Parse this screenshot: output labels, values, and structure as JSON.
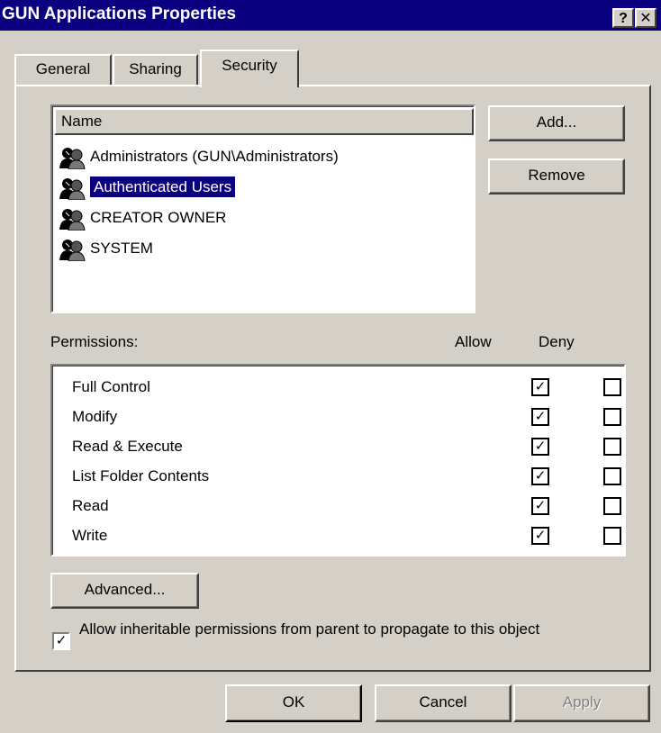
{
  "window": {
    "title": "GUN Applications Properties",
    "help_glyph": "?",
    "close_glyph": "✕"
  },
  "tabs": [
    {
      "label": "General"
    },
    {
      "label": "Sharing"
    },
    {
      "label": "Security",
      "active": true
    }
  ],
  "names": {
    "header": "Name",
    "items": [
      {
        "label": "Administrators (GUN\\Administrators)",
        "icon": "user-group-icon"
      },
      {
        "label": "Authenticated Users",
        "icon": "user-group-icon",
        "selected": true
      },
      {
        "label": "CREATOR OWNER",
        "icon": "user-group-icon"
      },
      {
        "label": "SYSTEM",
        "icon": "user-group-icon"
      }
    ]
  },
  "buttons": {
    "add": "Add...",
    "remove": "Remove",
    "advanced": "Advanced...",
    "ok": "OK",
    "cancel": "Cancel",
    "apply": "Apply"
  },
  "permissions": {
    "label": "Permissions:",
    "allow_header": "Allow",
    "deny_header": "Deny",
    "rows": [
      {
        "name": "Full Control",
        "allow": true,
        "deny": false
      },
      {
        "name": "Modify",
        "allow": true,
        "deny": false
      },
      {
        "name": "Read & Execute",
        "allow": true,
        "deny": false
      },
      {
        "name": "List Folder Contents",
        "allow": true,
        "deny": false
      },
      {
        "name": "Read",
        "allow": true,
        "deny": false
      },
      {
        "name": "Write",
        "allow": true,
        "deny": false
      }
    ]
  },
  "inherit": {
    "label": "Allow inheritable permissions from parent to propagate to this object",
    "checked": true
  },
  "colors": {
    "titlebar": "#0a0080",
    "face": "#d4d0c8",
    "selection": "#0a0080"
  }
}
